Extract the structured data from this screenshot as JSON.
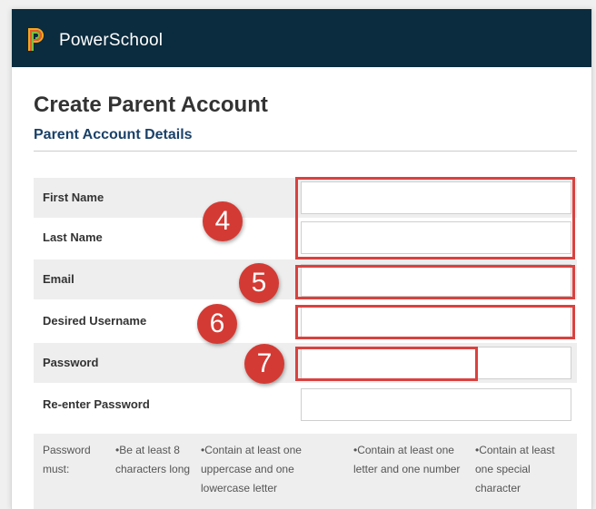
{
  "header": {
    "brand": "PowerSchool",
    "logo_icon": "powerschool-p-logo",
    "background": "#0b2b3e"
  },
  "page": {
    "title": "Create Parent Account",
    "section": "Parent Account Details"
  },
  "fields": [
    {
      "label": "First Name",
      "value": "",
      "shaded": true
    },
    {
      "label": "Last Name",
      "value": "",
      "shaded": false
    },
    {
      "label": "Email",
      "value": "",
      "shaded": true
    },
    {
      "label": "Desired Username",
      "value": "",
      "shaded": false
    },
    {
      "label": "Password",
      "value": "",
      "shaded": true
    },
    {
      "label": "Re-enter Password",
      "value": "",
      "shaded": false
    }
  ],
  "annotations": {
    "badges": [
      "4",
      "5",
      "6",
      "7"
    ],
    "highlight_color": "#d9423f",
    "badge_color": "#d43a34"
  },
  "password_rules": {
    "label": "Password must:",
    "items": [
      "•Be at least 8 characters long",
      "•Contain at least one uppercase and one lowercase letter",
      "•Contain at least one letter and one number",
      "•Contain at least one special character"
    ]
  }
}
